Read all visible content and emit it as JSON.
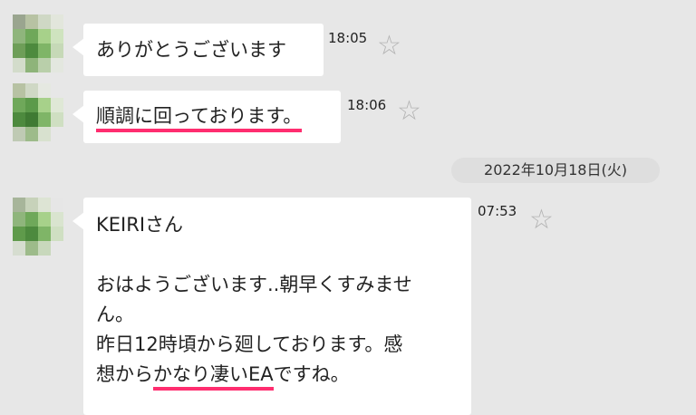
{
  "messages": [
    {
      "text": "ありがとうございます",
      "time": "18:05"
    },
    {
      "text": "順調に回っております。",
      "time": "18:06"
    }
  ],
  "date_separator": "2022年10月18日(火)",
  "message3": {
    "time": "07:53",
    "greeting": "KEIRIさん",
    "line1": "おはようございます..朝早くすみませ",
    "line2": "ん。",
    "line3": "昨日12時頃から廻しております。感",
    "line4_before": "想から",
    "line4_highlight": "かなり凄いEA",
    "line4_after": "ですね。"
  },
  "icons": {
    "star": "star-icon",
    "avatar": "avatar-image"
  },
  "colors": {
    "highlight_underline": "#ff2d6f",
    "background": "#e7e7e7"
  }
}
